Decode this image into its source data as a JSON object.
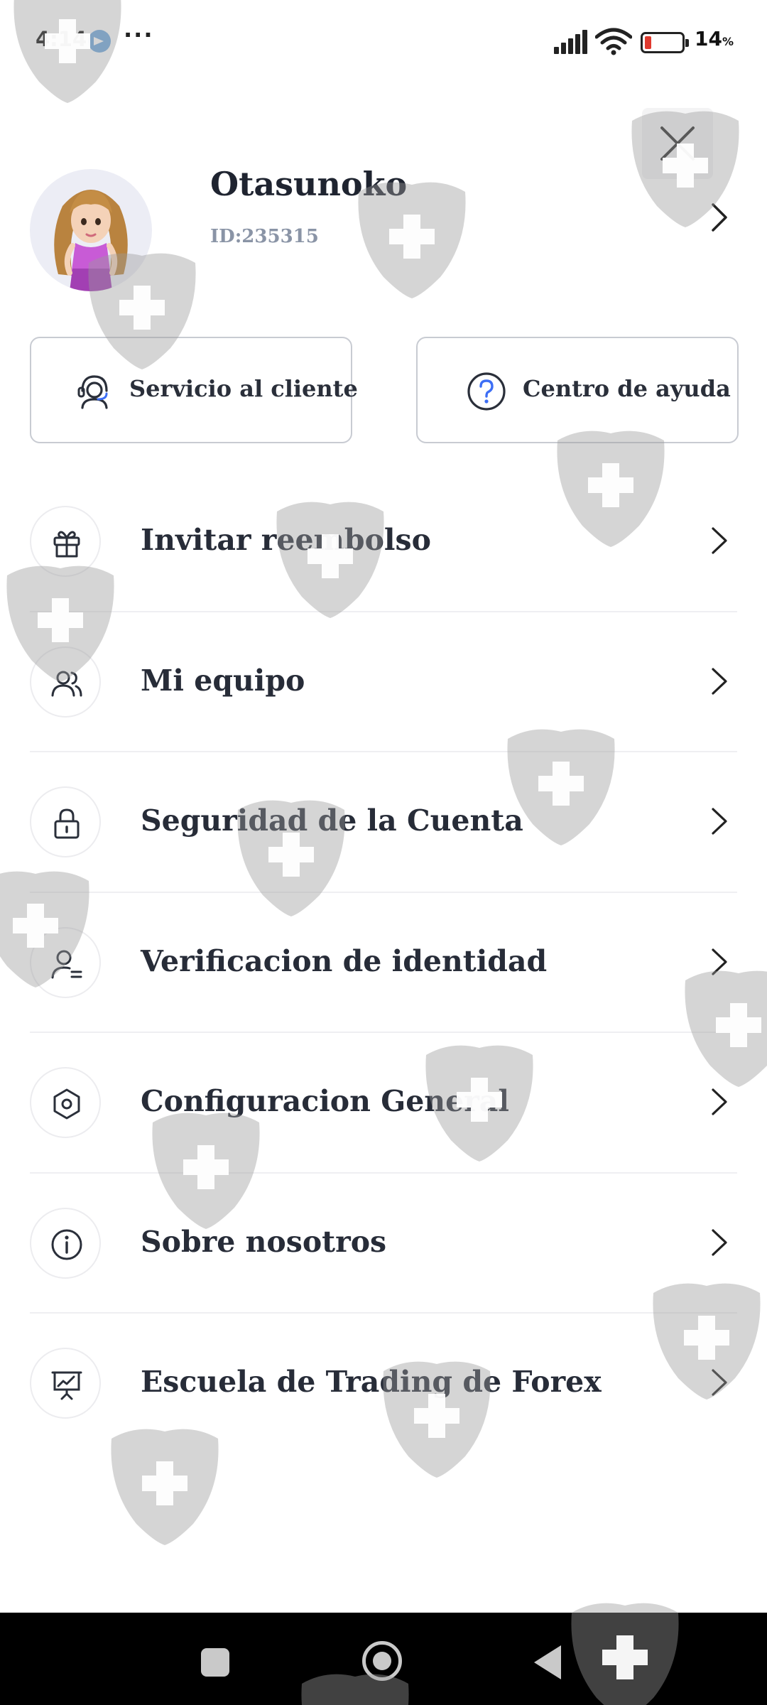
{
  "status_bar": {
    "time": "4:14",
    "more": "···",
    "battery_level": "14",
    "battery_unit": "%",
    "icons": [
      "telegram-icon",
      "signal-icon",
      "wifi-icon",
      "battery-icon"
    ]
  },
  "profile": {
    "username": "Otasunoko",
    "user_id": "ID:235315"
  },
  "quick_actions": {
    "customer_service": "Servicio al cliente",
    "help_center": "Centro de ayuda"
  },
  "menu": [
    {
      "label": "Invitar reembolso",
      "icon": "gift-icon"
    },
    {
      "label": "Mi equipo",
      "icon": "team-icon"
    },
    {
      "label": "Seguridad de la Cuenta",
      "icon": "lock-icon"
    },
    {
      "label": "Verificacion de identidad",
      "icon": "user-verify-icon"
    },
    {
      "label": "Configuracion General",
      "icon": "settings-hexagon-icon"
    },
    {
      "label": "Sobre nosotros",
      "icon": "info-icon"
    },
    {
      "label": "Escuela de Trading de Forex",
      "icon": "presentation-chart-icon"
    }
  ],
  "colors": {
    "text_primary": "#1f2430",
    "text_secondary": "#8a94a6",
    "border": "#c8cbd2",
    "battery_low": "#e03a2f",
    "nav_bar": "#000000"
  }
}
